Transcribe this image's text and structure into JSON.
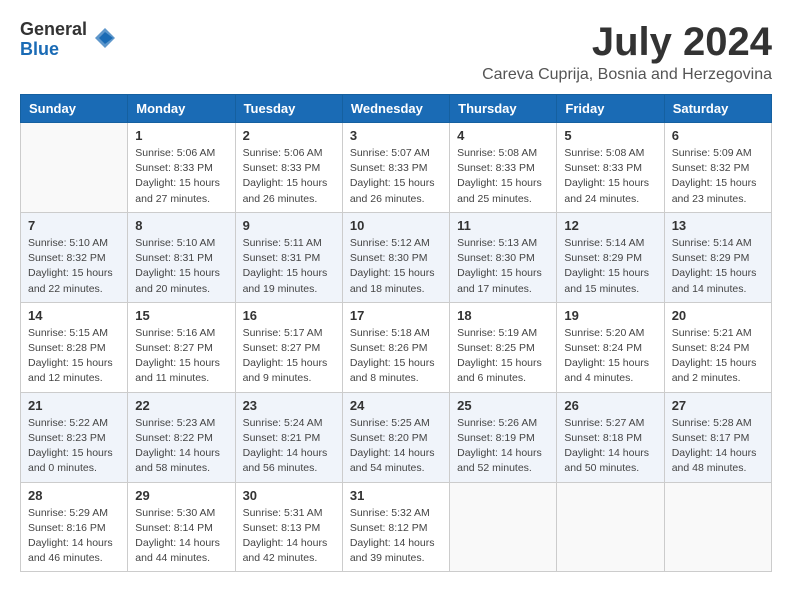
{
  "header": {
    "logo_line1": "General",
    "logo_line2": "Blue",
    "month_year": "July 2024",
    "location": "Careva Cuprija, Bosnia and Herzegovina"
  },
  "days_of_week": [
    "Sunday",
    "Monday",
    "Tuesday",
    "Wednesday",
    "Thursday",
    "Friday",
    "Saturday"
  ],
  "weeks": [
    [
      {
        "day": "",
        "info": ""
      },
      {
        "day": "1",
        "info": "Sunrise: 5:06 AM\nSunset: 8:33 PM\nDaylight: 15 hours\nand 27 minutes."
      },
      {
        "day": "2",
        "info": "Sunrise: 5:06 AM\nSunset: 8:33 PM\nDaylight: 15 hours\nand 26 minutes."
      },
      {
        "day": "3",
        "info": "Sunrise: 5:07 AM\nSunset: 8:33 PM\nDaylight: 15 hours\nand 26 minutes."
      },
      {
        "day": "4",
        "info": "Sunrise: 5:08 AM\nSunset: 8:33 PM\nDaylight: 15 hours\nand 25 minutes."
      },
      {
        "day": "5",
        "info": "Sunrise: 5:08 AM\nSunset: 8:33 PM\nDaylight: 15 hours\nand 24 minutes."
      },
      {
        "day": "6",
        "info": "Sunrise: 5:09 AM\nSunset: 8:32 PM\nDaylight: 15 hours\nand 23 minutes."
      }
    ],
    [
      {
        "day": "7",
        "info": "Sunrise: 5:10 AM\nSunset: 8:32 PM\nDaylight: 15 hours\nand 22 minutes."
      },
      {
        "day": "8",
        "info": "Sunrise: 5:10 AM\nSunset: 8:31 PM\nDaylight: 15 hours\nand 20 minutes."
      },
      {
        "day": "9",
        "info": "Sunrise: 5:11 AM\nSunset: 8:31 PM\nDaylight: 15 hours\nand 19 minutes."
      },
      {
        "day": "10",
        "info": "Sunrise: 5:12 AM\nSunset: 8:30 PM\nDaylight: 15 hours\nand 18 minutes."
      },
      {
        "day": "11",
        "info": "Sunrise: 5:13 AM\nSunset: 8:30 PM\nDaylight: 15 hours\nand 17 minutes."
      },
      {
        "day": "12",
        "info": "Sunrise: 5:14 AM\nSunset: 8:29 PM\nDaylight: 15 hours\nand 15 minutes."
      },
      {
        "day": "13",
        "info": "Sunrise: 5:14 AM\nSunset: 8:29 PM\nDaylight: 15 hours\nand 14 minutes."
      }
    ],
    [
      {
        "day": "14",
        "info": "Sunrise: 5:15 AM\nSunset: 8:28 PM\nDaylight: 15 hours\nand 12 minutes."
      },
      {
        "day": "15",
        "info": "Sunrise: 5:16 AM\nSunset: 8:27 PM\nDaylight: 15 hours\nand 11 minutes."
      },
      {
        "day": "16",
        "info": "Sunrise: 5:17 AM\nSunset: 8:27 PM\nDaylight: 15 hours\nand 9 minutes."
      },
      {
        "day": "17",
        "info": "Sunrise: 5:18 AM\nSunset: 8:26 PM\nDaylight: 15 hours\nand 8 minutes."
      },
      {
        "day": "18",
        "info": "Sunrise: 5:19 AM\nSunset: 8:25 PM\nDaylight: 15 hours\nand 6 minutes."
      },
      {
        "day": "19",
        "info": "Sunrise: 5:20 AM\nSunset: 8:24 PM\nDaylight: 15 hours\nand 4 minutes."
      },
      {
        "day": "20",
        "info": "Sunrise: 5:21 AM\nSunset: 8:24 PM\nDaylight: 15 hours\nand 2 minutes."
      }
    ],
    [
      {
        "day": "21",
        "info": "Sunrise: 5:22 AM\nSunset: 8:23 PM\nDaylight: 15 hours\nand 0 minutes."
      },
      {
        "day": "22",
        "info": "Sunrise: 5:23 AM\nSunset: 8:22 PM\nDaylight: 14 hours\nand 58 minutes."
      },
      {
        "day": "23",
        "info": "Sunrise: 5:24 AM\nSunset: 8:21 PM\nDaylight: 14 hours\nand 56 minutes."
      },
      {
        "day": "24",
        "info": "Sunrise: 5:25 AM\nSunset: 8:20 PM\nDaylight: 14 hours\nand 54 minutes."
      },
      {
        "day": "25",
        "info": "Sunrise: 5:26 AM\nSunset: 8:19 PM\nDaylight: 14 hours\nand 52 minutes."
      },
      {
        "day": "26",
        "info": "Sunrise: 5:27 AM\nSunset: 8:18 PM\nDaylight: 14 hours\nand 50 minutes."
      },
      {
        "day": "27",
        "info": "Sunrise: 5:28 AM\nSunset: 8:17 PM\nDaylight: 14 hours\nand 48 minutes."
      }
    ],
    [
      {
        "day": "28",
        "info": "Sunrise: 5:29 AM\nSunset: 8:16 PM\nDaylight: 14 hours\nand 46 minutes."
      },
      {
        "day": "29",
        "info": "Sunrise: 5:30 AM\nSunset: 8:14 PM\nDaylight: 14 hours\nand 44 minutes."
      },
      {
        "day": "30",
        "info": "Sunrise: 5:31 AM\nSunset: 8:13 PM\nDaylight: 14 hours\nand 42 minutes."
      },
      {
        "day": "31",
        "info": "Sunrise: 5:32 AM\nSunset: 8:12 PM\nDaylight: 14 hours\nand 39 minutes."
      },
      {
        "day": "",
        "info": ""
      },
      {
        "day": "",
        "info": ""
      },
      {
        "day": "",
        "info": ""
      }
    ]
  ]
}
